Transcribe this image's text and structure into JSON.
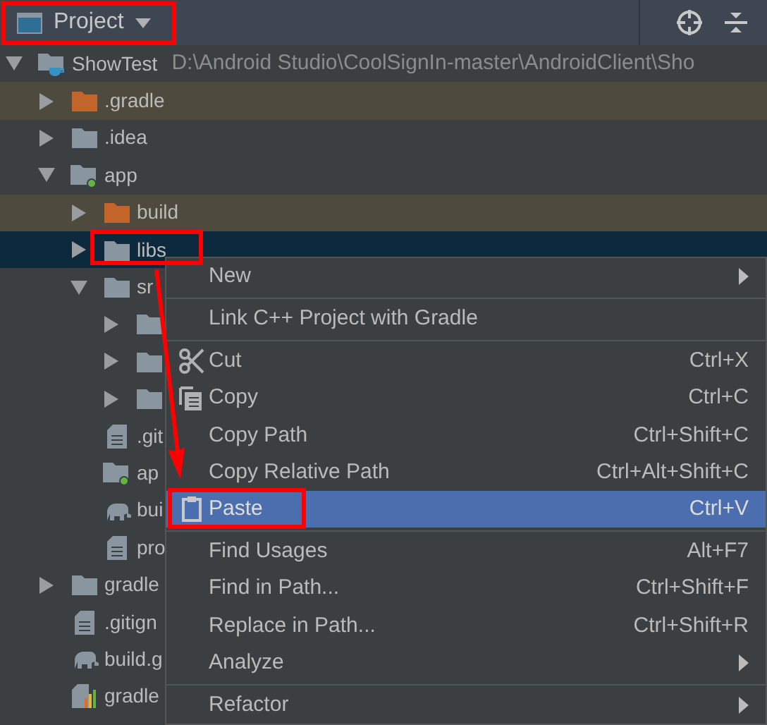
{
  "header": {
    "title": "Project"
  },
  "tree": [
    {
      "name": "ShowTest",
      "path": "D:\\Android Studio\\CoolSignIn-master\\AndroidClient\\Sho",
      "kind": "project",
      "expanded": true,
      "excluded": false,
      "selected": false,
      "children": [
        {
          "name": ".gradle",
          "kind": "folder",
          "expanded": false,
          "excluded": true,
          "selected": false
        },
        {
          "name": ".idea",
          "kind": "folder",
          "expanded": false,
          "excluded": false,
          "selected": false
        },
        {
          "name": "app",
          "kind": "module",
          "expanded": true,
          "excluded": false,
          "selected": false,
          "children": [
            {
              "name": "build",
              "kind": "folder",
              "expanded": false,
              "excluded": true,
              "selected": false
            },
            {
              "name": "libs",
              "kind": "folder",
              "expanded": false,
              "excluded": false,
              "selected": true
            },
            {
              "name": "sr",
              "kind": "folder",
              "expanded": true,
              "excluded": false,
              "selected": false,
              "children": [
                {
                  "kind": "folder",
                  "expanded": false,
                  "excluded": false,
                  "selected": false
                },
                {
                  "kind": "folder",
                  "expanded": false,
                  "excluded": false,
                  "selected": false
                },
                {
                  "kind": "folder",
                  "expanded": false,
                  "excluded": false,
                  "selected": false
                }
              ]
            },
            {
              "name": ".git",
              "kind": "file",
              "excluded": false,
              "selected": false
            },
            {
              "name": "ap",
              "kind": "module",
              "excluded": false,
              "selected": false
            },
            {
              "name": "bui",
              "kind": "gradle",
              "excluded": false,
              "selected": false
            },
            {
              "name": "pro",
              "kind": "file",
              "excluded": false,
              "selected": false
            }
          ]
        },
        {
          "name": "gradle",
          "kind": "folder",
          "expanded": false,
          "excluded": false,
          "selected": false
        },
        {
          "name": ".gitign",
          "kind": "file",
          "excluded": false,
          "selected": false
        },
        {
          "name": "build.g",
          "kind": "gradle",
          "excluded": false,
          "selected": false
        },
        {
          "name": "gradle",
          "kind": "properties",
          "excluded": false,
          "selected": false
        }
      ]
    }
  ],
  "context_menu": [
    {
      "kind": "item",
      "label": "New",
      "submenu": true,
      "selected": false
    },
    {
      "kind": "separator"
    },
    {
      "kind": "item",
      "label": "Link C++ Project with Gradle",
      "selected": false
    },
    {
      "kind": "separator"
    },
    {
      "kind": "cut",
      "label": "Cut",
      "shortcut": "Ctrl+X",
      "selected": false
    },
    {
      "kind": "copy",
      "label": "Copy",
      "shortcut": "Ctrl+C",
      "selected": false
    },
    {
      "kind": "item",
      "label": "Copy Path",
      "shortcut": "Ctrl+Shift+C",
      "selected": false
    },
    {
      "kind": "item",
      "label": "Copy Relative Path",
      "shortcut": "Ctrl+Alt+Shift+C",
      "selected": false
    },
    {
      "kind": "paste",
      "label": "Paste",
      "shortcut": "Ctrl+V",
      "selected": true
    },
    {
      "kind": "separator"
    },
    {
      "kind": "item",
      "label": "Find Usages",
      "shortcut": "Alt+F7",
      "selected": false
    },
    {
      "kind": "item",
      "label": "Find in Path...",
      "shortcut": "Ctrl+Shift+F",
      "selected": false
    },
    {
      "kind": "item",
      "label": "Replace in Path...",
      "shortcut": "Ctrl+Shift+R",
      "selected": false
    },
    {
      "kind": "item",
      "label": "Analyze",
      "submenu": true,
      "selected": false
    },
    {
      "kind": "separator"
    },
    {
      "kind": "item",
      "label": "Refactor",
      "submenu": true,
      "selected": false
    }
  ]
}
